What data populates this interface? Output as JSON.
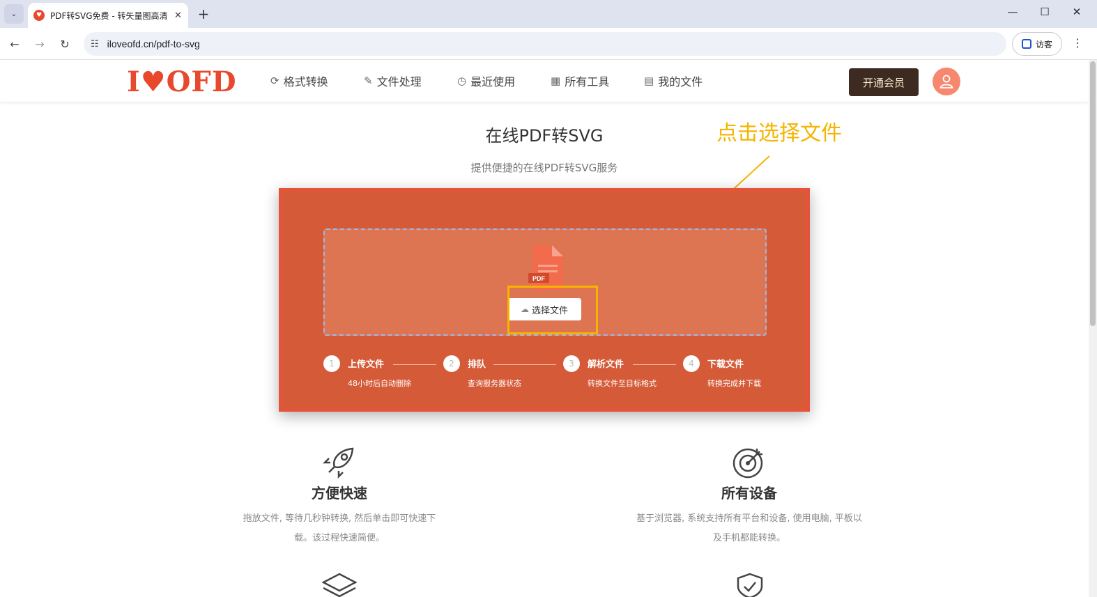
{
  "browser": {
    "tab_title": "PDF转SVG免费 - 转矢量图高清",
    "tab_close": "✕",
    "new_tab": "+",
    "url": "iloveofd.cn/pdf-to-svg",
    "guest_label": "访客",
    "minimize": "—",
    "maximize": "☐",
    "close": "✕",
    "back": "←",
    "forward": "→",
    "reload": "↻",
    "kebab": "⋮",
    "tab_menu": "⌄"
  },
  "header": {
    "logo": "I♥OFD",
    "nav": [
      {
        "icon": "⟳",
        "icon_name": "convert-icon",
        "label": "格式转换"
      },
      {
        "icon": "✎",
        "icon_name": "file-process-icon",
        "label": "文件处理"
      },
      {
        "icon": "◷",
        "icon_name": "recent-icon",
        "label": "最近使用"
      },
      {
        "icon": "▦",
        "icon_name": "tools-icon",
        "label": "所有工具"
      },
      {
        "icon": "▤",
        "icon_name": "my-files-icon",
        "label": "我的文件"
      }
    ],
    "vip_label": "开通会员",
    "avatar_icon": "👤"
  },
  "main": {
    "title": "在线PDF转SVG",
    "subtitle": "提供便捷的在线PDF转SVG服务",
    "annotation": "点击选择文件",
    "upload": {
      "file_badge": "PDF",
      "choose_label": "选择文件"
    },
    "steps": [
      {
        "num": "1",
        "title": "上传文件",
        "desc": "48小时后自动删除"
      },
      {
        "num": "2",
        "title": "排队",
        "desc": "查询服务器状态"
      },
      {
        "num": "3",
        "title": "解析文件",
        "desc": "转换文件至目标格式"
      },
      {
        "num": "4",
        "title": "下载文件",
        "desc": "转换完成并下载"
      }
    ]
  },
  "features": [
    {
      "title": "方便快速",
      "desc": "拖放文件, 等待几秒钟转换, 然后单击即可快速下载。该过程快速简便。"
    },
    {
      "title": "所有设备",
      "desc": "基于浏览器, 系统支持所有平台和设备, 使用电脑, 平板以及手机都能转换。"
    }
  ],
  "colors": {
    "brand": "#e8482c",
    "panel": "#d45a38",
    "annotation": "#f5b400",
    "vip": "#3d2b21"
  }
}
